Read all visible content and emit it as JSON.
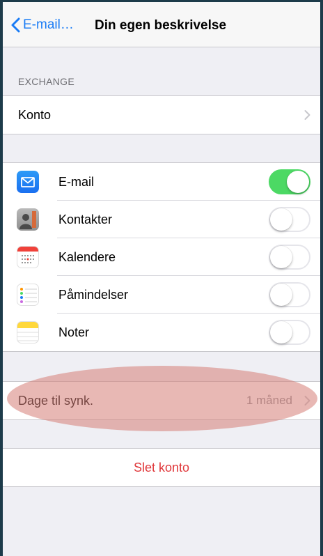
{
  "nav": {
    "back_label": "E-mail…",
    "title": "Din egen beskrivelse"
  },
  "exchange": {
    "header": "EXCHANGE",
    "account_label": "Konto"
  },
  "services": [
    {
      "label": "E-mail",
      "icon": "mail-icon",
      "enabled": true
    },
    {
      "label": "Kontakter",
      "icon": "contacts-icon",
      "enabled": false
    },
    {
      "label": "Kalendere",
      "icon": "calendar-icon",
      "enabled": false
    },
    {
      "label": "Påmindelser",
      "icon": "reminders-icon",
      "enabled": false
    },
    {
      "label": "Noter",
      "icon": "notes-icon",
      "enabled": false
    }
  ],
  "sync": {
    "label": "Dage til synk.",
    "value": "1 måned"
  },
  "delete_label": "Slet konto",
  "colors": {
    "accent": "#1a7cf5",
    "toggle_on": "#4cd964",
    "destructive": "#e0383b",
    "highlight": "#d67e76"
  }
}
